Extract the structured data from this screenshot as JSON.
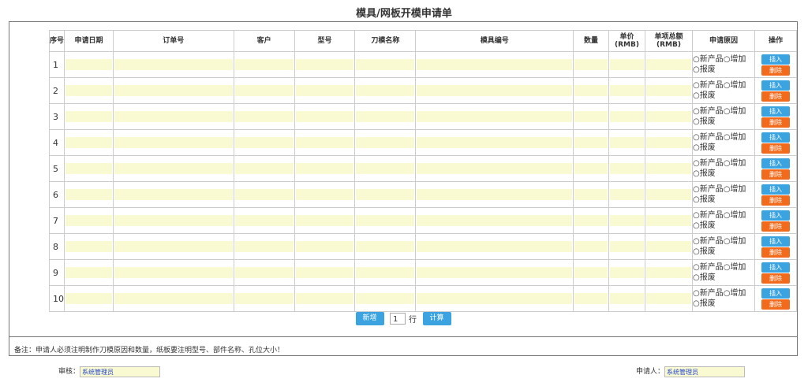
{
  "title": "模具/网板开模申请单",
  "headers": [
    "序号",
    "申请日期",
    "订单号",
    "客户",
    "型号",
    "刀模名称",
    "模具编号",
    "数量",
    "单价(RMB)",
    "单项总额(RMB)",
    "申请原因",
    "操作"
  ],
  "rows": [
    1,
    2,
    3,
    4,
    5,
    6,
    7,
    8,
    9,
    10
  ],
  "reason_options": {
    "new_product": "新产品",
    "increase": "增加",
    "scrap": "报废"
  },
  "row_actions": {
    "insert": "插入",
    "delete": "删除"
  },
  "footer": {
    "add_label": "新增",
    "row_count": "1",
    "row_unit": "行",
    "calculate_label": "计算"
  },
  "note": "备注：申请人必须注明制作刀模原因和数量，纸板要注明型号、部件名称、孔位大小！",
  "approval": {
    "reviewer_label": "审核：",
    "reviewer_value": "系统管理员",
    "applicant_label": "申请人：",
    "applicant_value": "系统管理员"
  },
  "colors": {
    "input_fill": "#fafad2",
    "insert_button": "#3ba3e0",
    "delete_button": "#f26a1b",
    "user_text": "#2244cc"
  }
}
